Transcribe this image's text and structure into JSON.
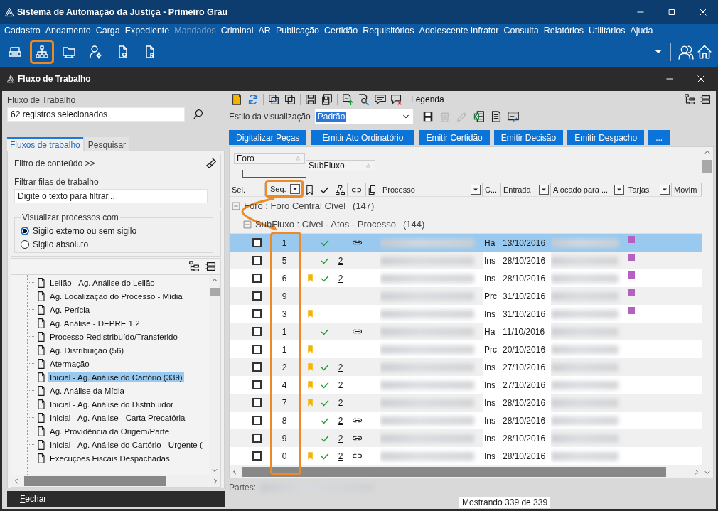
{
  "window": {
    "title": "Sistema de Automação da Justiça - Primeiro Grau"
  },
  "menu": [
    {
      "label": "Cadastro",
      "disabled": false
    },
    {
      "label": "Andamento",
      "disabled": false
    },
    {
      "label": "Carga",
      "disabled": false
    },
    {
      "label": "Expediente",
      "disabled": false
    },
    {
      "label": "Mandados",
      "disabled": true
    },
    {
      "label": "Criminal",
      "disabled": false
    },
    {
      "label": "AR",
      "disabled": false
    },
    {
      "label": "Publicação",
      "disabled": false
    },
    {
      "label": "Certidão",
      "disabled": false
    },
    {
      "label": "Requisitórios",
      "disabled": false
    },
    {
      "label": "Adolescente Infrator",
      "disabled": false
    },
    {
      "label": "Consulta",
      "disabled": false
    },
    {
      "label": "Relatórios",
      "disabled": false
    },
    {
      "label": "Utilitários",
      "disabled": false
    },
    {
      "label": "Ajuda",
      "disabled": false
    }
  ],
  "toolbar": [
    {
      "highlighted": false
    },
    {
      "highlighted": true
    },
    {
      "highlighted": false
    },
    {
      "highlighted": false
    },
    {
      "highlighted": false
    },
    {
      "highlighted": false
    }
  ],
  "child_window": {
    "title": "Fluxo de Trabalho"
  },
  "left_panel": {
    "flow_label": "Fluxo de Trabalho",
    "flow_value": "62 registros selecionados",
    "tabs": [
      {
        "label": "Fluxos de trabalho",
        "selected": true
      },
      {
        "label": "Pesquisar",
        "selected": false
      }
    ],
    "content_filter": "Filtro de conteúdo >>",
    "queue_filter_label": "Filtrar filas de trabalho",
    "queue_filter": {
      "placeholder": "Digite o texto para filtrar..."
    },
    "visibility": {
      "legend": "Visualizar processos com",
      "options": [
        {
          "label": "Sigilo externo ou sem sigilo",
          "selected": true
        },
        {
          "label": "Sigilo absoluto",
          "selected": false
        }
      ]
    },
    "tree": [
      {
        "label": "Leilão - Ag. Análise do Leilão",
        "selected": false
      },
      {
        "label": "Ag. Localização do Processo - Mídia",
        "selected": false
      },
      {
        "label": "Ag. Perícia",
        "selected": false
      },
      {
        "label": "Ag. Análise - DEPRE 1.2",
        "selected": false
      },
      {
        "label": "Processo Redistribuído/Transferido",
        "selected": false
      },
      {
        "label": "Ag. Distribuição (56)",
        "selected": false
      },
      {
        "label": "Atermação",
        "selected": false
      },
      {
        "label": "Inicial - Ag. Análise do Cartório (339)",
        "selected": true
      },
      {
        "label": "Ag. Análise da Mídia",
        "selected": false
      },
      {
        "label": "Inicial  - Ag. Análise do Distribuidor",
        "selected": false
      },
      {
        "label": "Inicial - Ag. Analise - Carta Precatória",
        "selected": false
      },
      {
        "label": "Ag. Providência da Origem/Parte",
        "selected": false
      },
      {
        "label": "Inicial - Ag. Análise do Cartório - Urgente (",
        "selected": false
      },
      {
        "label": "Execuções Fiscais Despachadas",
        "selected": false
      }
    ],
    "close_button": "Fechar"
  },
  "right_panel": {
    "legend_label": "Legenda",
    "style_label": "Estilo da visualização",
    "style_value": "Padrão",
    "style_tools": [
      {
        "disabled": false
      },
      {
        "disabled": true
      },
      {
        "disabled": true
      },
      {
        "disabled": false
      },
      {
        "disabled": false
      },
      {
        "disabled": false
      }
    ],
    "actions": [
      "Digitalizar Peças",
      "Emitir Ato Ordinatório",
      "Emitir Certidão",
      "Emitir Decisão",
      "Emitir Despacho",
      "..."
    ],
    "group_by": [
      "Foro",
      "SubFluxo"
    ],
    "table": {
      "columns": [
        {
          "kind": "text",
          "label": "Sel.",
          "filter": false,
          "highlighted": false
        },
        {
          "kind": "text",
          "label": "Seq.",
          "filter": true,
          "highlighted": true
        },
        {
          "kind": "icon"
        },
        {
          "kind": "icon"
        },
        {
          "kind": "icon"
        },
        {
          "kind": "icon"
        },
        {
          "kind": "icon"
        },
        {
          "kind": "text",
          "label": "Processo",
          "filter": true,
          "highlighted": false
        },
        {
          "kind": "text",
          "label": "C...",
          "filter": false,
          "highlighted": false
        },
        {
          "kind": "text",
          "label": "Entrada",
          "filter": true,
          "highlighted": false
        },
        {
          "kind": "text",
          "label": "Alocado para ...",
          "filter": true,
          "highlighted": false
        },
        {
          "kind": "text",
          "label": "Tarjas",
          "filter": true,
          "highlighted": false
        },
        {
          "kind": "text",
          "label": "Movim",
          "filter": false,
          "highlighted": false
        }
      ],
      "groups": [
        {
          "label": "Foro : Foro Central Cível",
          "count": "(147)",
          "expanded": true
        },
        {
          "label": "SubFluxo : Cível - Atos - Processo",
          "count": "(144)",
          "expanded": true
        }
      ],
      "rows": [
        {
          "selected": true,
          "checked": false,
          "seq": "1",
          "bookmark": false,
          "done": true,
          "count": "",
          "linked": true,
          "c": "Ha",
          "date": "13/10/2016",
          "tarja": true
        },
        {
          "selected": false,
          "checked": false,
          "seq": "5",
          "bookmark": false,
          "done": true,
          "count": "2",
          "linked": false,
          "c": "Ins",
          "date": "28/10/2016",
          "tarja": true
        },
        {
          "selected": false,
          "checked": false,
          "seq": "6",
          "bookmark": true,
          "done": true,
          "count": "2",
          "linked": false,
          "c": "Ins",
          "date": "28/10/2016",
          "tarja": true
        },
        {
          "selected": false,
          "checked": false,
          "seq": "9",
          "bookmark": false,
          "done": false,
          "count": "",
          "linked": false,
          "c": "Prc",
          "date": "31/10/2016",
          "tarja": true
        },
        {
          "selected": false,
          "checked": false,
          "seq": "3",
          "bookmark": true,
          "done": false,
          "count": "",
          "linked": false,
          "c": "Ins",
          "date": "31/10/2016",
          "tarja": true
        },
        {
          "selected": false,
          "checked": false,
          "seq": "1",
          "bookmark": false,
          "done": true,
          "count": "",
          "linked": true,
          "c": "Ha",
          "date": "11/10/2016",
          "tarja": false
        },
        {
          "selected": false,
          "checked": false,
          "seq": "1",
          "bookmark": true,
          "done": false,
          "count": "",
          "linked": false,
          "c": "Prc",
          "date": "20/10/2016",
          "tarja": false
        },
        {
          "selected": false,
          "checked": false,
          "seq": "2",
          "bookmark": true,
          "done": true,
          "count": "2",
          "linked": false,
          "c": "Ins",
          "date": "27/10/2016",
          "tarja": false
        },
        {
          "selected": false,
          "checked": false,
          "seq": "4",
          "bookmark": true,
          "done": true,
          "count": "2",
          "linked": false,
          "c": "Ins",
          "date": "27/10/2016",
          "tarja": false
        },
        {
          "selected": false,
          "checked": false,
          "seq": "7",
          "bookmark": true,
          "done": true,
          "count": "2",
          "linked": false,
          "c": "Ins",
          "date": "28/10/2016",
          "tarja": false
        },
        {
          "selected": false,
          "checked": false,
          "seq": "8",
          "bookmark": false,
          "done": true,
          "count": "2",
          "linked": true,
          "c": "Ins",
          "date": "28/10/2016",
          "tarja": false
        },
        {
          "selected": false,
          "checked": false,
          "seq": "9",
          "bookmark": false,
          "done": true,
          "count": "2",
          "linked": true,
          "c": "Ins",
          "date": "28/10/2016",
          "tarja": false
        },
        {
          "selected": false,
          "checked": false,
          "seq": "0",
          "bookmark": true,
          "done": true,
          "count": "2",
          "linked": true,
          "c": "Ins",
          "date": "28/10/2016",
          "tarja": false
        }
      ]
    },
    "parties_label": "Partes:",
    "status": "Mostrando 339 de 339"
  }
}
